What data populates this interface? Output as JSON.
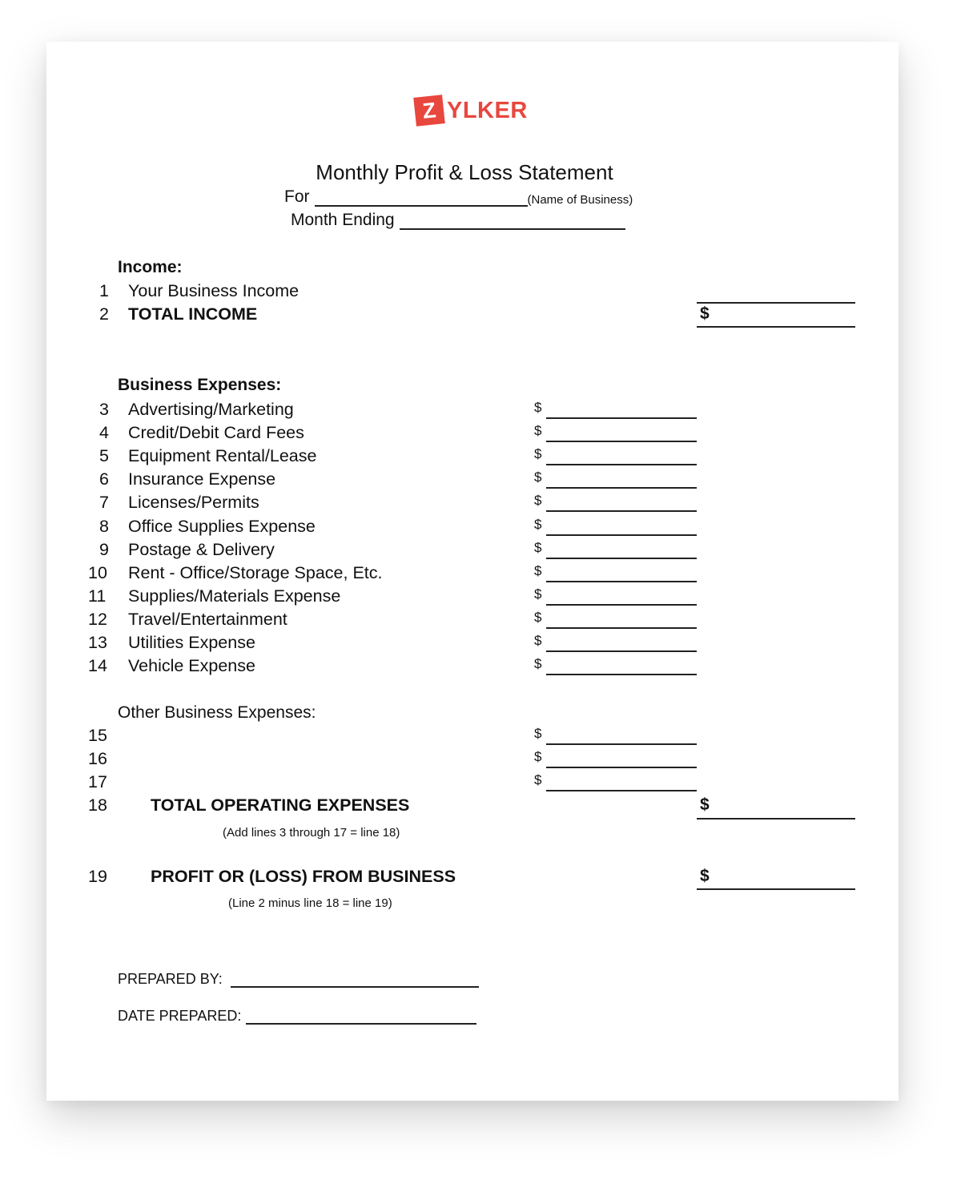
{
  "brand": {
    "logo_letter": "Z",
    "logo_rest": "YLKER",
    "color": "#e8473e"
  },
  "header": {
    "title": "Monthly Profit & Loss Statement",
    "for_label": "For",
    "business_note": "(Name of Business)",
    "month_label": "Month Ending"
  },
  "income": {
    "heading": "Income:",
    "rows": [
      {
        "num": "1",
        "label": "Your Business Income"
      },
      {
        "num": "2",
        "label": "TOTAL INCOME",
        "currency": "$"
      }
    ]
  },
  "expenses": {
    "heading": "Business Expenses:",
    "currency": "$",
    "rows": [
      {
        "num": "3",
        "label": "Advertising/Marketing"
      },
      {
        "num": "4",
        "label": "Credit/Debit Card Fees"
      },
      {
        "num": "5",
        "label": "Equipment Rental/Lease"
      },
      {
        "num": "6",
        "label": "Insurance Expense"
      },
      {
        "num": "7",
        "label": "Licenses/Permits"
      },
      {
        "num": "8",
        "label": "Office Supplies Expense"
      },
      {
        "num": "9",
        "label": "Postage & Delivery"
      },
      {
        "num": "10",
        "label": "Rent - Office/Storage Space, Etc."
      },
      {
        "num": "11",
        "label": "Supplies/Materials Expense"
      },
      {
        "num": "12",
        "label": "Travel/Entertainment"
      },
      {
        "num": "13",
        "label": "Utilities Expense"
      },
      {
        "num": "14",
        "label": "Vehicle Expense"
      }
    ]
  },
  "other_expenses": {
    "heading": "Other Business Expenses:",
    "rows": [
      {
        "num": "15",
        "label": ""
      },
      {
        "num": "16",
        "label": ""
      },
      {
        "num": "17",
        "label": ""
      }
    ]
  },
  "totals": {
    "operating": {
      "num": "18",
      "label": "TOTAL OPERATING EXPENSES",
      "hint": "(Add lines 3 through 17 = line 18)",
      "currency": "$"
    },
    "profit": {
      "num": "19",
      "label": "PROFIT OR (LOSS) FROM BUSINESS",
      "hint": "(Line 2 minus line 18 = line 19)",
      "currency": "$"
    }
  },
  "footer": {
    "prepared_by": "PREPARED BY:",
    "date_prepared": "DATE PREPARED:"
  }
}
